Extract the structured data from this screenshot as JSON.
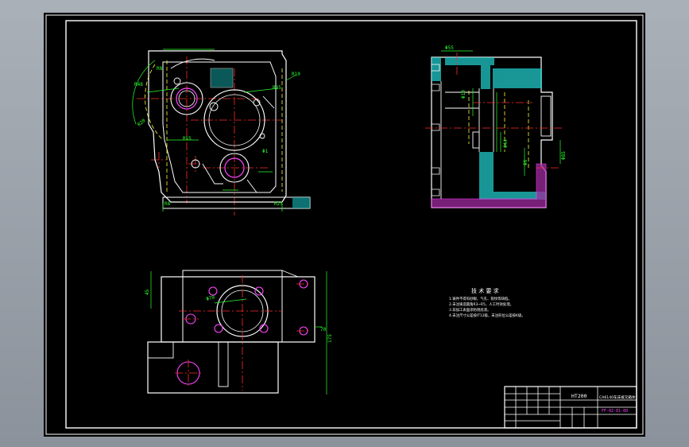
{
  "sheet": {
    "background": "#000000",
    "viewport_background": "#9aa1aa",
    "border_color": "#ffffff"
  },
  "colors": {
    "outline": "#ffffff",
    "centerline": "#ff2b2b",
    "dimension": "#2bff2b",
    "hidden": "#ffff33",
    "hatch": "#21c8c8",
    "feature": "#ff44ff"
  },
  "front_view": {
    "dims": [
      "R8",
      "R48",
      "R10",
      "R35",
      "R20",
      "R55",
      "Φ1",
      "R8",
      "R25"
    ]
  },
  "section_view": {
    "dims": [
      "Φ55",
      "Φ10",
      "Φ44",
      "Φ6",
      "Φ85"
    ]
  },
  "plan_view": {
    "dims": [
      "Φ70",
      "45",
      "175",
      "70"
    ]
  },
  "notes": {
    "title": "技 术 要 求",
    "lines": [
      "1.铸件不得有砂眼、气孔、裂纹等缺陷。",
      "2.未注铸造圆角R3~R5，人工时效处理。",
      "3.非加工表面涂防锈底漆。",
      "4.未注尺寸公差按IT12级，未注形位公差按K级。"
    ]
  },
  "title_block": {
    "material": "HT200",
    "drawing_name": "CA6140车床拨叉箱体",
    "drawing_no": "FF-02-01-00"
  }
}
